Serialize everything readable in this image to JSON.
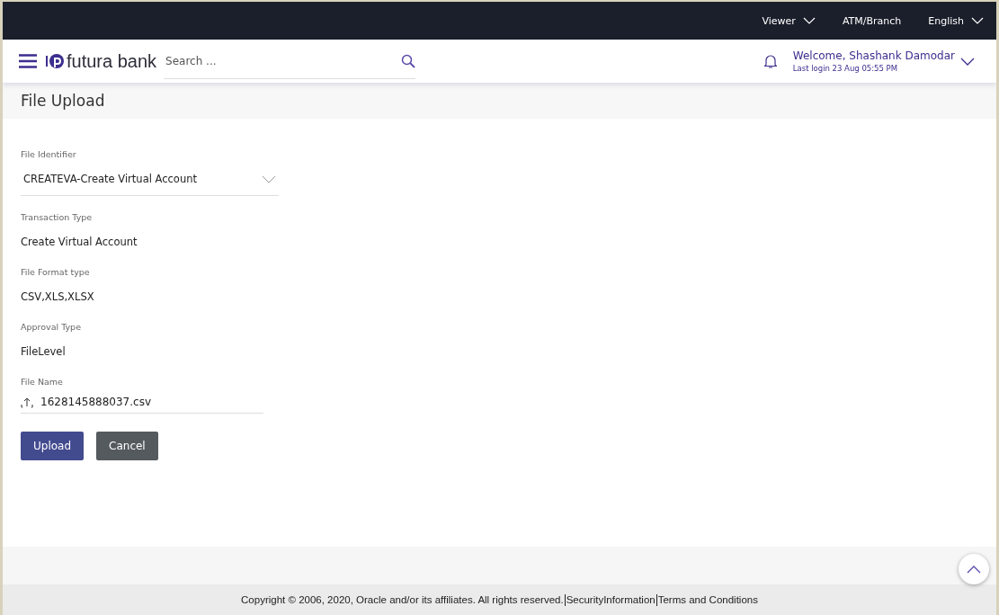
{
  "top_bar": {
    "items": [
      {
        "label": "Viewer",
        "has_caret": true
      },
      {
        "label": "ATM/Branch",
        "has_caret": false
      },
      {
        "label": "English",
        "has_caret": true
      }
    ]
  },
  "header": {
    "logo": "futura bank",
    "search": {
      "placeholder": "Search ..."
    },
    "welcome": "Welcome, Shashank Damodar",
    "last_login": "Last login 23 Aug 05:55 PM"
  },
  "page_title": "File Upload",
  "fields": [
    {
      "kind": "dropdown",
      "label": "File Identifier",
      "value": "CREATEVA-Create Virtual Account"
    },
    {
      "kind": "text",
      "label": "Transaction Type",
      "value": "Create Virtual Account"
    },
    {
      "kind": "text",
      "label": "File Format type",
      "value": "CSV,XLS,XLSX"
    },
    {
      "kind": "text",
      "label": "Approval Type",
      "value": "FileLevel"
    },
    {
      "kind": "file",
      "label": "File Name",
      "value": "1628145888037.csv"
    }
  ],
  "buttons": [
    {
      "label": "Upload",
      "kind": "primary"
    },
    {
      "label": "Cancel",
      "kind": "secondary"
    }
  ],
  "footer": {
    "copyright": "Copyright © 2006, 2020, Oracle and/or its affiliates. All rights reserved.",
    "links": [
      "SecurityInformation",
      "Terms and Conditions"
    ]
  }
}
